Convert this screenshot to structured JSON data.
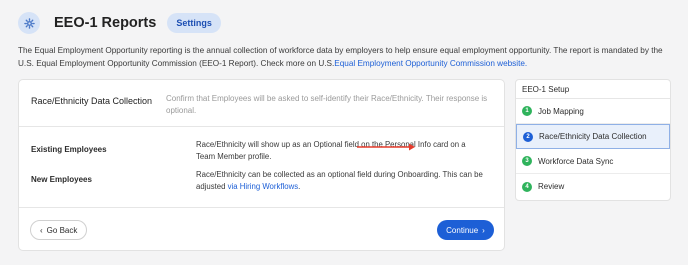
{
  "header": {
    "title": "EEO-1 Reports",
    "settings_label": "Settings"
  },
  "intro": {
    "text": "The Equal Employment Opportunity reporting is the annual collection of workforce data by employers to help ensure equal employment opportunity. The report is mandated by the U.S. Equal Employment Opportunity Commission (EEO-1 Report). Check more on U.S.",
    "link": "Equal Employment Opportunity Commission website."
  },
  "card": {
    "title": "Race/Ethnicity Data Collection",
    "description": "Confirm that Employees will be asked to self-identify their Race/Ethnicity. Their response is optional.",
    "rows": [
      {
        "label": "Existing Employees",
        "text": "Race/Ethnicity will show up as an Optional field on the Personal Info card on a Team Member profile.",
        "link": ""
      },
      {
        "label": "New Employees",
        "text": "Race/Ethnicity can be collected as an optional field during Onboarding. This can be adjusted ",
        "link": "via Hiring Workflows",
        "suffix": "."
      }
    ],
    "back_label": "Go Back",
    "continue_label": "Continue"
  },
  "setup": {
    "title": "EEO-1 Setup",
    "steps": [
      {
        "num": "1",
        "label": "Job Mapping"
      },
      {
        "num": "2",
        "label": "Race/Ethnicity Data Collection"
      },
      {
        "num": "3",
        "label": "Workforce Data Sync"
      },
      {
        "num": "4",
        "label": "Review"
      }
    ]
  },
  "colors": {
    "accent": "#1d5fd6",
    "complete": "#2fb35c",
    "arrow": "#e53b2c"
  }
}
